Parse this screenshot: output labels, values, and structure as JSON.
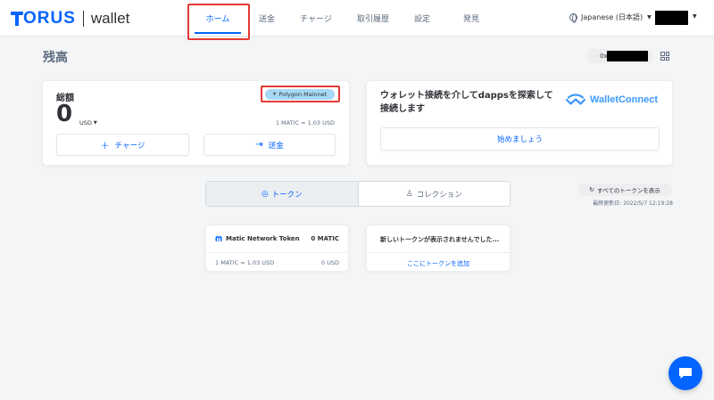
{
  "header": {
    "logo_brand": "ORUS",
    "logo_product": "wallet",
    "nav": [
      {
        "label": "ホーム",
        "active": true
      },
      {
        "label": "送金",
        "active": false
      },
      {
        "label": "チャージ",
        "active": false
      },
      {
        "label": "取引履歴",
        "active": false
      },
      {
        "label": "設定",
        "active": false
      },
      {
        "label": "発見",
        "active": false
      }
    ],
    "language": "Japanese (日本語)"
  },
  "page": {
    "title": "残高",
    "address_prefix": "0x"
  },
  "balance_card": {
    "label": "総額",
    "network": "Polygon Mainnet",
    "value": "0",
    "currency": "USD",
    "rate": "1 MATIC = 1.03 USD",
    "topup_label": "チャージ",
    "send_label": "送金"
  },
  "walletconnect_card": {
    "text": "ウォレット接続を介してdappsを探索して接続します",
    "logo_text": "WalletConnect",
    "start_label": "始めましょう"
  },
  "tabs": [
    {
      "label": "トークン",
      "active": true
    },
    {
      "label": "コレクション",
      "active": false
    }
  ],
  "refresh": {
    "label": "すべてのトークンを表示",
    "updated": "最終更新日: 2022/5/7 12:19:28"
  },
  "token": {
    "name": "Matic Network Token",
    "amount": "0 MATIC",
    "rate": "1 MATIC = 1.03 USD",
    "usd": "0 USD"
  },
  "add_token": {
    "title": "新しいトークンが表示されませんでした...",
    "link": "ここにトークンを追加"
  },
  "colors": {
    "accent": "#0364ff",
    "network_pill": "#a7d9f5",
    "highlight": "#e53935",
    "walletconnect": "#3b99fc"
  }
}
